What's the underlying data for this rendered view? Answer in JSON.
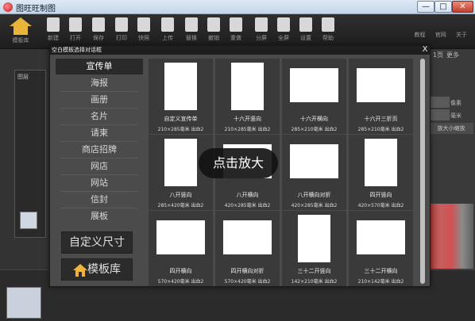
{
  "window": {
    "title": "图旺旺制图",
    "min": "—",
    "max": "□",
    "close": "✕"
  },
  "toolbar": {
    "logo_label": "模板库",
    "items": [
      {
        "label": "新建",
        "icon": "new-file-icon"
      },
      {
        "label": "打开",
        "icon": "folder-icon"
      },
      {
        "label": "保存",
        "icon": "save-icon"
      },
      {
        "label": "打印",
        "icon": "print-icon"
      },
      {
        "label": "快照",
        "icon": "camera-icon"
      },
      {
        "label": "上传",
        "icon": "upload-icon"
      },
      {
        "label": "替换",
        "icon": "replace-icon"
      },
      {
        "label": "撤销",
        "icon": "undo-icon"
      },
      {
        "label": "重做",
        "icon": "redo-icon"
      },
      {
        "label": "分屏",
        "icon": "split-icon"
      },
      {
        "label": "全屏",
        "icon": "fullscreen-icon"
      },
      {
        "label": "设置",
        "icon": "gear-icon"
      },
      {
        "label": "帮助",
        "icon": "help-icon"
      }
    ],
    "links": [
      "教程",
      "官网",
      "关于"
    ]
  },
  "background": {
    "layers_label": "图层",
    "page_label": "1页",
    "more_label": "更多",
    "right_labels": [
      "像素",
      "毫米",
      "放大小缩放"
    ]
  },
  "dialog": {
    "title": "空白模板选择对话框",
    "close": "X",
    "categories": [
      "宣传单",
      "海报",
      "画册",
      "名片",
      "请柬",
      "商店招牌",
      "网店",
      "网站",
      "信封",
      "展板"
    ],
    "custom_size": "自定义尺寸",
    "template_library": "模板库",
    "zoom_hint": "点击放大",
    "templates": [
      {
        "name": "自定义宣传单",
        "size": "210×285毫米 出血2"
      },
      {
        "name": "十六开竖向",
        "size": "210×285毫米 出血2"
      },
      {
        "name": "十六开横向",
        "size": "285×210毫米 出血2"
      },
      {
        "name": "十六开三折页",
        "size": "285×210毫米 出血2"
      },
      {
        "name": "八开竖向",
        "size": "285×420毫米 出血2"
      },
      {
        "name": "八开横向",
        "size": "420×285毫米 出血2"
      },
      {
        "name": "八开横向对折",
        "size": "420×285毫米 出血2"
      },
      {
        "name": "四开竖向",
        "size": "420×570毫米 出血2"
      },
      {
        "name": "四开横向",
        "size": "570×420毫米 出血2"
      },
      {
        "name": "四开横向对折",
        "size": "570×420毫米 出血2"
      },
      {
        "name": "三十二开竖向",
        "size": "142×210毫米 出血2"
      },
      {
        "name": "三十二开横向",
        "size": "210×142毫米 出血2"
      }
    ]
  },
  "colors": {
    "accent": "#f0b43a",
    "dialog_bg": "#4b4b4b",
    "card_bg": "#3a3a3a"
  }
}
